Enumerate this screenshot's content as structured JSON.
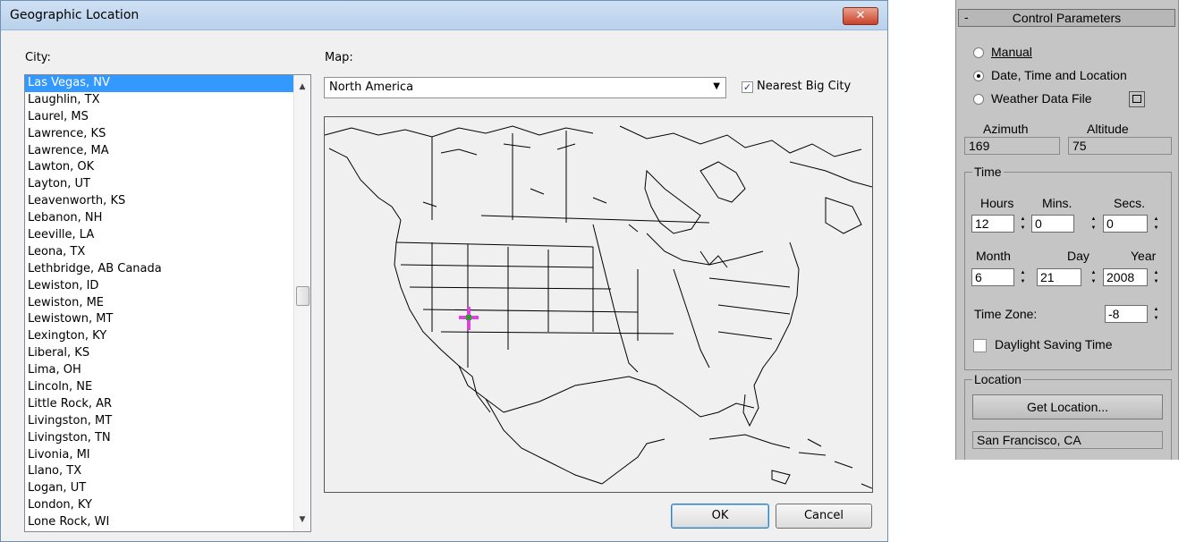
{
  "dialog": {
    "title": "Geographic Location",
    "close_glyph": "✕",
    "city_label": "City:",
    "map_label": "Map:",
    "map_selected": "North America",
    "nearest_big_city_label": "Nearest Big City",
    "nearest_big_city_checked": true,
    "ok_label": "OK",
    "cancel_label": "Cancel",
    "cities": [
      "Las Vegas, NV",
      "Laughlin, TX",
      "Laurel, MS",
      "Lawrence, KS",
      "Lawrence, MA",
      "Lawton, OK",
      "Layton, UT",
      "Leavenworth, KS",
      "Lebanon, NH",
      "Leeville, LA",
      "Leona, TX",
      "Lethbridge, AB Canada",
      "Lewiston, ID",
      "Lewiston, ME",
      "Lewistown, MT",
      "Lexington, KY",
      "Liberal, KS",
      "Lima, OH",
      "Lincoln, NE",
      "Little Rock, AR",
      "Livingston, MT",
      "Livingston, TN",
      "Livonia, MI",
      "Llano, TX",
      "Logan, UT",
      "London, KY",
      "Lone Rock, WI"
    ],
    "selected_city_index": 0,
    "marker_color": "#e040e0",
    "selection_color": "#3399ff"
  },
  "panel": {
    "header": "Control Parameters",
    "collapse_glyph": "-",
    "modes": [
      {
        "label": "Manual",
        "selected": false
      },
      {
        "label": "Date, Time and Location",
        "selected": true
      },
      {
        "label": "Weather Data File",
        "selected": false
      }
    ],
    "azimuth_label": "Azimuth",
    "altitude_label": "Altitude",
    "azimuth": "169",
    "altitude": "75",
    "time_group": "Time",
    "hours_label": "Hours",
    "mins_label": "Mins.",
    "secs_label": "Secs.",
    "hours": "12",
    "mins": "0",
    "secs": "0",
    "month_label": "Month",
    "day_label": "Day",
    "year_label": "Year",
    "month": "6",
    "day": "21",
    "year": "2008",
    "timezone_label": "Time Zone:",
    "timezone": "-8",
    "dst_label": "Daylight Saving Time",
    "dst_checked": false,
    "location_group": "Location",
    "get_location_label": "Get Location...",
    "location_value": "San Francisco, CA"
  }
}
